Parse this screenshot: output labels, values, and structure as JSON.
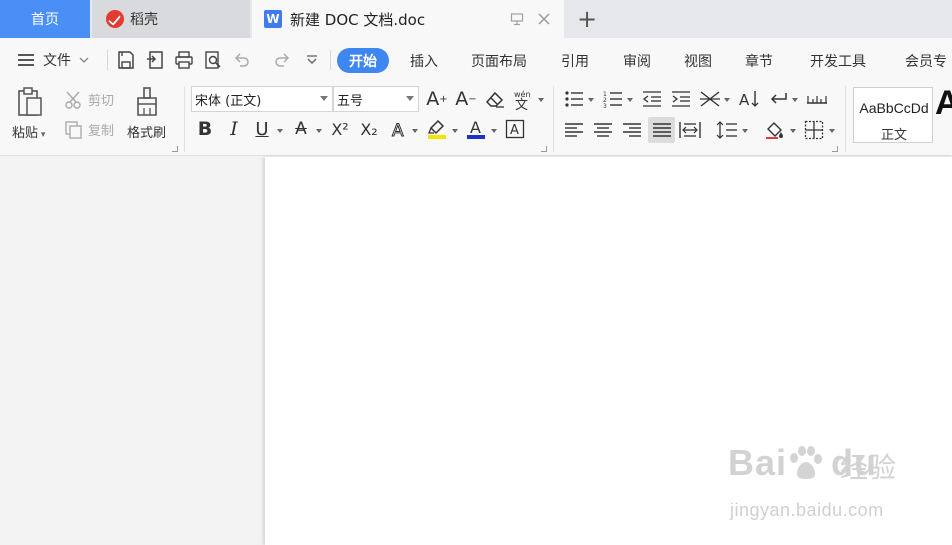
{
  "tabs": {
    "home": "首页",
    "daoke": "稻壳",
    "document": "新建 DOC 文档.doc",
    "doc_icon_letter": "W",
    "new_tab": "+"
  },
  "menu": {
    "file": "文件",
    "items": [
      "开始",
      "插入",
      "页面布局",
      "引用",
      "审阅",
      "视图",
      "章节",
      "开发工具",
      "会员专"
    ],
    "active": "开始"
  },
  "ribbon": {
    "clipboard": {
      "paste": "粘贴",
      "cut": "剪切",
      "copy": "复制",
      "format_painter": "格式刷"
    },
    "font": {
      "family": "宋体 (正文)",
      "size": "五号",
      "buttons": [
        "B",
        "I",
        "U",
        "A",
        "X²",
        "X₂",
        "A",
        "A",
        "A"
      ]
    },
    "styles": {
      "sample": "AaBbCcDd",
      "name": "正文",
      "next_sample": "A"
    }
  },
  "watermark": {
    "brand": "Bai",
    "brand_suffix": "du",
    "product": "经验",
    "url": "jingyan.baidu.com"
  },
  "colors": {
    "accent": "#3e86f0",
    "home_tab": "#4a8ff5",
    "highlight_yellow": "#f6e300",
    "font_color_blue": "#1d33c9"
  }
}
